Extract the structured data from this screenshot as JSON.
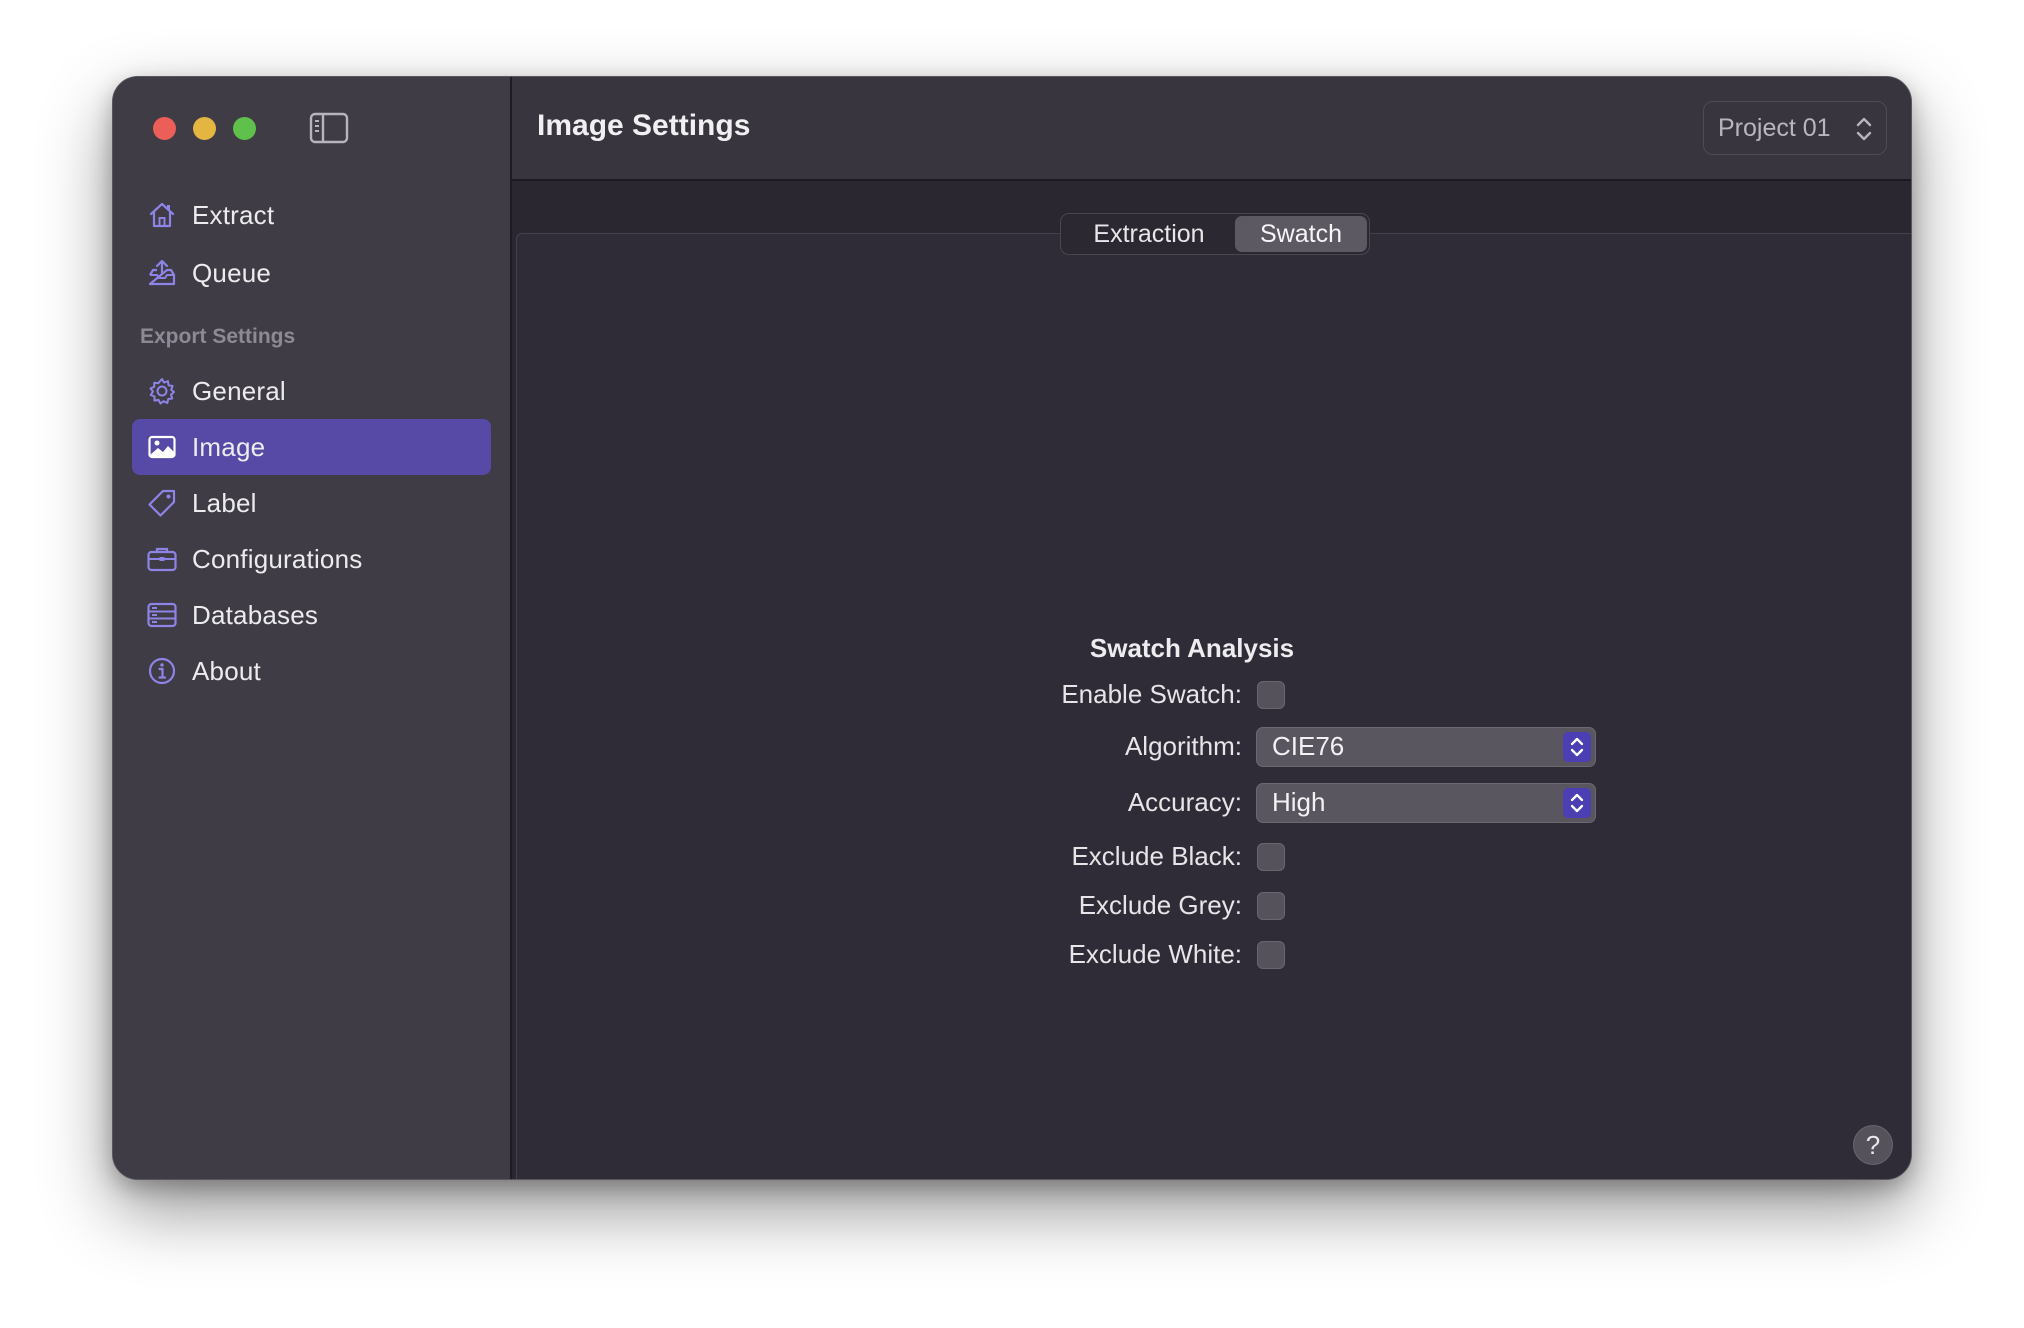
{
  "window": {
    "accent_color": "#564aa6",
    "traffic_lights": [
      "close",
      "minimize",
      "zoom"
    ]
  },
  "sidebar": {
    "top_items": [
      {
        "label": "Extract",
        "icon": "house-icon"
      },
      {
        "label": "Queue",
        "icon": "tray-upload-icon"
      }
    ],
    "section_header": "Export Settings",
    "items": [
      {
        "label": "General",
        "icon": "gear-icon"
      },
      {
        "label": "Image",
        "icon": "photo-icon",
        "selected": true
      },
      {
        "label": "Label",
        "icon": "tag-icon"
      },
      {
        "label": "Configurations",
        "icon": "briefcase-icon"
      },
      {
        "label": "Databases",
        "icon": "server-rack-icon"
      },
      {
        "label": "About",
        "icon": "info-circle-icon"
      }
    ]
  },
  "toolbar": {
    "title": "Image Settings",
    "project_selector": {
      "value": "Project 01"
    }
  },
  "tabs": [
    {
      "label": "Extraction",
      "active": false
    },
    {
      "label": "Swatch",
      "active": true
    }
  ],
  "form": {
    "title": "Swatch Analysis",
    "enable_swatch": {
      "label": "Enable Swatch:",
      "checked": false
    },
    "algorithm": {
      "label": "Algorithm:",
      "value": "CIE76"
    },
    "accuracy": {
      "label": "Accuracy:",
      "value": "High"
    },
    "exclude_black": {
      "label": "Exclude Black:",
      "checked": false
    },
    "exclude_grey": {
      "label": "Exclude Grey:",
      "checked": false
    },
    "exclude_white": {
      "label": "Exclude White:",
      "checked": false
    }
  },
  "help": {
    "label": "?"
  }
}
